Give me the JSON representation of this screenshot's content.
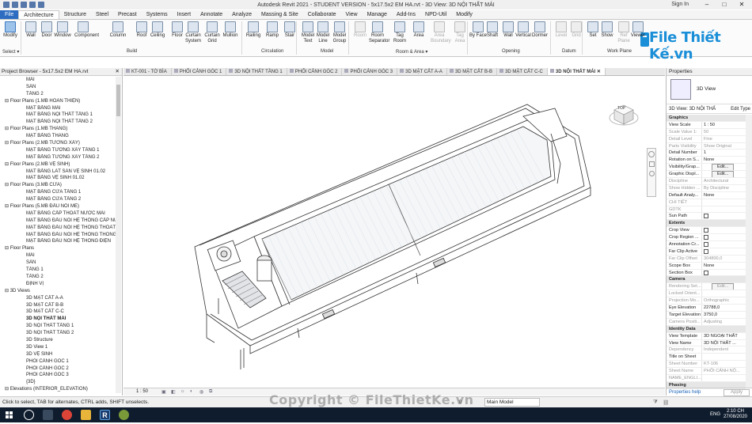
{
  "window": {
    "title": "Autodesk Revit 2021 - STUDENT VERSION - 5x17.5x2 EM HA.rvt - 3D View: 3D NỘI THẤT MÁI",
    "sign_in": "Sign In"
  },
  "tabs": [
    "File",
    "Architecture",
    "Structure",
    "Steel",
    "Precast",
    "Systems",
    "Insert",
    "Annotate",
    "Analyze",
    "Massing & Site",
    "Collaborate",
    "View",
    "Manage",
    "Add-Ins",
    "NPD-Util",
    "Modify"
  ],
  "active_tab": "Architecture",
  "ribbon": {
    "tools": [
      "Modify",
      "Wall",
      "Door",
      "Window",
      "Component",
      "Column",
      "Roof",
      "Ceiling",
      "Floor",
      "Curtain System",
      "Curtain Grid",
      "Mullion",
      "Railing",
      "Ramp",
      "Stair",
      "Model Text",
      "Model Line",
      "Model Group",
      "Room",
      "Room Separator",
      "Tag Room",
      "Area",
      "Area Boundary",
      "Tag Area",
      "By Face",
      "Shaft",
      "Wall",
      "Vertical",
      "Dormer",
      "Level",
      "Grid",
      "Set",
      "Show",
      "Ref Plane",
      "Viewer"
    ],
    "groups": [
      "Select ▾",
      "Build",
      "Circulation",
      "Model",
      "Room & Area ▾",
      "Opening",
      "Datum",
      "Work Plane"
    ]
  },
  "logo": {
    "text": "File Thiết Kế.vn"
  },
  "project_browser": {
    "title": "Project Browser - 5x17.5x2 EM HA.rvt",
    "items": [
      "MÁI",
      "SÂN",
      "TẦNG 2",
      "Floor Plans (1.MB HOÀN THIỆN)",
      "MẶT BẰNG MÁI",
      "MẶT BẰNG NỘI THẤT TẦNG 1",
      "MẶT BẰNG NỘI THẤT TẦNG 2",
      "Floor Plans (1.MB THANG)",
      "MẶT BẰNG THANG",
      "Floor Plans (2.MB TƯỜNG XÂY)",
      "MẶT BẰNG TƯỜNG XÂY TẦNG 1",
      "MẶT BẰNG TƯỜNG XÂY TẦNG 2",
      "Floor Plans (2.MB VỆ SINH)",
      "MẶT BẰNG LÁT SÀN VỆ SINH 01.02",
      "MẶT BẰNG VỆ SINH 01.02",
      "Floor Plans (3.MB CỬA)",
      "MẶT BẰNG CỬA TẦNG 1",
      "MẶT BẰNG CỬA TẦNG 2",
      "Floor Plans (5.MB ĐẦU NỐI ME)",
      "MẶT BẰNG CẤP THOÁT NƯỚC MÁI",
      "MẶT BẰNG ĐẦU NỐI HỆ THỐNG CẤP NƯỚC",
      "MẶT BẰNG ĐẦU NỐI HỆ THỐNG THOÁT N",
      "MẶT BẰNG ĐẦU NỐI HỆ THỐNG THÔNG T",
      "MẶT BẰNG ĐẦU NỐI HỆ THỐNG ĐIỆN",
      "Floor Plans",
      "MÁI",
      "SÂN",
      "TẦNG 1",
      "TẦNG 2",
      "ĐỊNH VỊ",
      "3D Views",
      "3D MẶT CẮT A-A",
      "3D MẶT CẮT B-B",
      "3D MẶT CẮT C-C",
      "3D NỘI THẤT MÁI",
      "3D NỘI THẤT TẦNG 1",
      "3D NỘI THẤT TẦNG 2",
      "3D Structure",
      "3D View 1",
      "3D VỆ SINH",
      "PHỐI CẢNH GÓC 1",
      "PHỐI CẢNH GÓC 2",
      "PHỐI CẢNH GÓC 3",
      "{3D}",
      "Elevations (INTERIOR_ELEVATION)"
    ]
  },
  "view_tabs": [
    "KT-001 - TỜ BÌA",
    "PHỐI CẢNH GÓC 1",
    "3D NỘI THẤT TẦNG 1",
    "PHỐI CẢNH GÓC 2",
    "PHỐI CẢNH GÓC 3",
    "3D MẶT CẮT A-A",
    "3D MẶT CẮT B-B",
    "3D MẶT CẮT C-C",
    "3D NỘI THẤT MÁI"
  ],
  "viewcube": {
    "face": "TOP"
  },
  "view_bar": {
    "scale": "1 : 50"
  },
  "properties": {
    "title": "Properties",
    "type_name": "3D View",
    "selector": "3D View: 3D NỘI THẤ",
    "edit_type": "Edit Type",
    "rows": [
      {
        "k": "Graphics",
        "v": "",
        "cat": true
      },
      {
        "k": "View Scale",
        "v": "1 : 50"
      },
      {
        "k": "Scale Value    1:",
        "v": "50",
        "dim": true
      },
      {
        "k": "Detail Level",
        "v": "Fine",
        "dim": true
      },
      {
        "k": "Parts Visibility",
        "v": "Show Original",
        "dim": true
      },
      {
        "k": "Detail Number",
        "v": "1"
      },
      {
        "k": "Rotation on S...",
        "v": "None"
      },
      {
        "k": "Visibility/Grap...",
        "v": "Edit...",
        "btn": true
      },
      {
        "k": "Graphic Displ...",
        "v": "Edit...",
        "btn": true
      },
      {
        "k": "Discipline",
        "v": "Architectural",
        "dim": true
      },
      {
        "k": "Show Hidden ...",
        "v": "By Discipline",
        "dim": true
      },
      {
        "k": "Default Analy...",
        "v": "None"
      },
      {
        "k": "CHI TIẾT",
        "v": "",
        "dim": true
      },
      {
        "k": "GDTK",
        "v": "",
        "dim": true
      },
      {
        "k": "Sun Path",
        "v": "",
        "cb": true
      },
      {
        "k": "Extents",
        "v": "",
        "cat": true
      },
      {
        "k": "Crop View",
        "v": "",
        "cb": true
      },
      {
        "k": "Crop Region ...",
        "v": "",
        "cb": true
      },
      {
        "k": "Annotation Cr...",
        "v": "",
        "cb": true
      },
      {
        "k": "Far Clip Active",
        "v": "",
        "cb": true
      },
      {
        "k": "Far Clip Offset",
        "v": "304800,0",
        "dim": true
      },
      {
        "k": "Scope Box",
        "v": "None"
      },
      {
        "k": "Section Box",
        "v": "",
        "cb": true
      },
      {
        "k": "Camera",
        "v": "",
        "cat": true
      },
      {
        "k": "Rendering Set...",
        "v": "Edit...",
        "btn": true,
        "dim": true
      },
      {
        "k": "Locked Orient...",
        "v": "",
        "dim": true
      },
      {
        "k": "Projection Mo...",
        "v": "Orthographic",
        "dim": true
      },
      {
        "k": "Eye Elevation",
        "v": "22788,0"
      },
      {
        "k": "Target Elevation",
        "v": "3750,0"
      },
      {
        "k": "Camera Positi...",
        "v": "Adjusting",
        "dim": true
      },
      {
        "k": "Identity Data",
        "v": "",
        "cat": true
      },
      {
        "k": "View Template",
        "v": "3D NGOẠI THẤT"
      },
      {
        "k": "View Name",
        "v": "3D NỘI THẤT ..."
      },
      {
        "k": "Dependency",
        "v": "Independent",
        "dim": true
      },
      {
        "k": "Title on Sheet",
        "v": ""
      },
      {
        "k": "Sheet Number",
        "v": "KT-106",
        "dim": true
      },
      {
        "k": "Sheet Name",
        "v": "PHỐI CẢNH NỘ...",
        "dim": true
      },
      {
        "k": "NAME_ENGLI...",
        "v": "",
        "dim": true
      },
      {
        "k": "Phasing",
        "v": "",
        "cat": true
      }
    ],
    "help": "Properties help",
    "apply": "Apply"
  },
  "status": {
    "hint": "Click to select, TAB for alternates, CTRL adds, SHIFT unselects.",
    "model": "Main Model",
    "zero": ":0"
  },
  "watermark": "Copyright © FileThietKe.vn",
  "taskbar": {
    "lang": "ENG",
    "time": "2:10 CH",
    "date": "27/08/2020"
  }
}
